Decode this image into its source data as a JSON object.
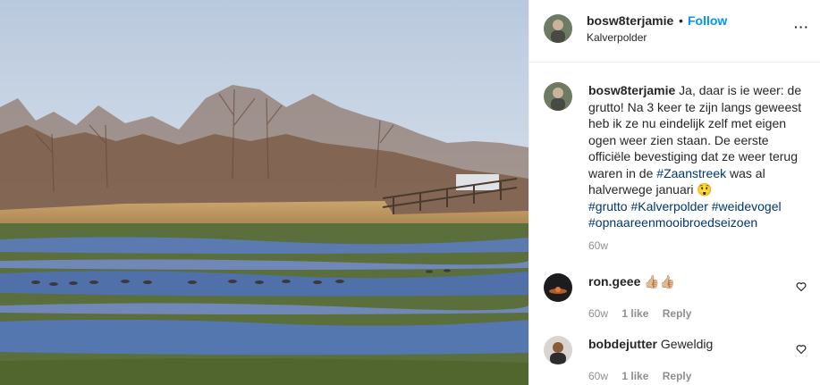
{
  "post": {
    "username": "bosw8terjamie",
    "follow_separator": "•",
    "follow_label": "Follow",
    "location": "Kalverpolder",
    "more_label": "···",
    "caption": {
      "username": "bosw8terjamie",
      "text_before": " Ja, daar is ie weer: de grutto! Na 3 keer te zijn langs geweest heb ik ze nu eindelijk zelf met eigen ogen weer zien staan. De eerste officiële bevestiging dat ze weer terug waren in de ",
      "tag_inline": "#Zaanstreek",
      "text_after": " was al halverwege januari 😲",
      "tags": [
        "#grutto",
        "#Kalverpolder",
        "#weidevogel",
        "#opnaareenmooibroedseizoen"
      ],
      "time": "60w"
    },
    "comments": [
      {
        "username": "ron.geee",
        "text": "👍🏼👍🏼",
        "time": "60w",
        "likes": "1 like",
        "reply": "Reply"
      },
      {
        "username": "bobdejutter",
        "text": "Geweldig",
        "time": "60w",
        "likes": "1 like",
        "reply": "Reply"
      }
    ]
  },
  "icons": {
    "heart": "heart-icon",
    "more": "more-options-icon"
  },
  "colors": {
    "follow": "#0095f6",
    "hashtag": "#00376b",
    "muted": "#8e8e8e",
    "text": "#262626"
  }
}
